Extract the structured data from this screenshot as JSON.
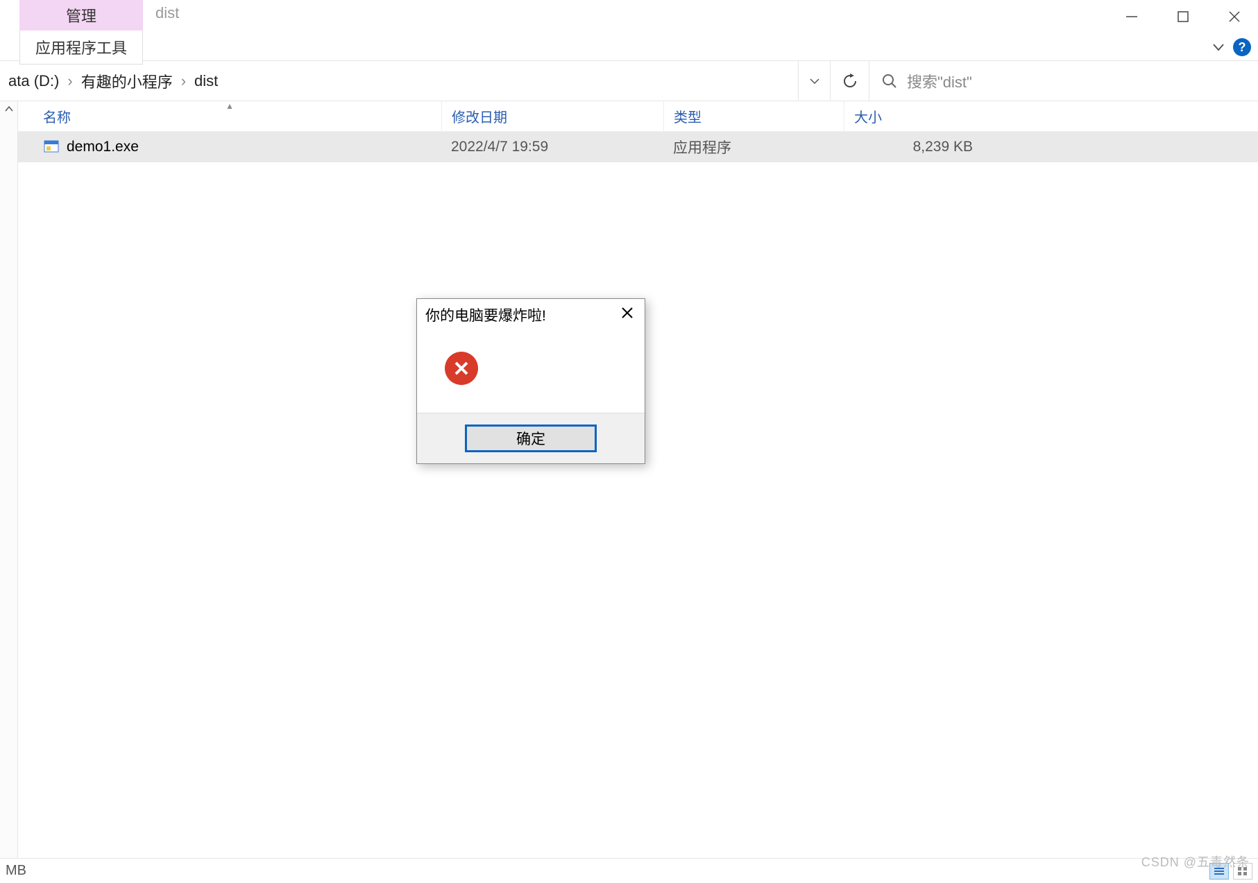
{
  "window": {
    "title": "dist",
    "ribbon_tab_top": "管理",
    "ribbon_tab_bottom": "应用程序工具"
  },
  "breadcrumb": {
    "drive": "ata (D:)",
    "folder1": "有趣的小程序",
    "folder2": "dist"
  },
  "search": {
    "placeholder": "搜索\"dist\""
  },
  "columns": {
    "name": "名称",
    "date": "修改日期",
    "type": "类型",
    "size": "大小"
  },
  "files": [
    {
      "name": "demo1.exe",
      "date": "2022/4/7 19:59",
      "type": "应用程序",
      "size": "8,239 KB"
    }
  ],
  "statusbar": {
    "left": "MB"
  },
  "dialog": {
    "title": "你的电脑要爆炸啦!",
    "ok": "确定"
  },
  "watermark": "CSDN @五毒然条"
}
